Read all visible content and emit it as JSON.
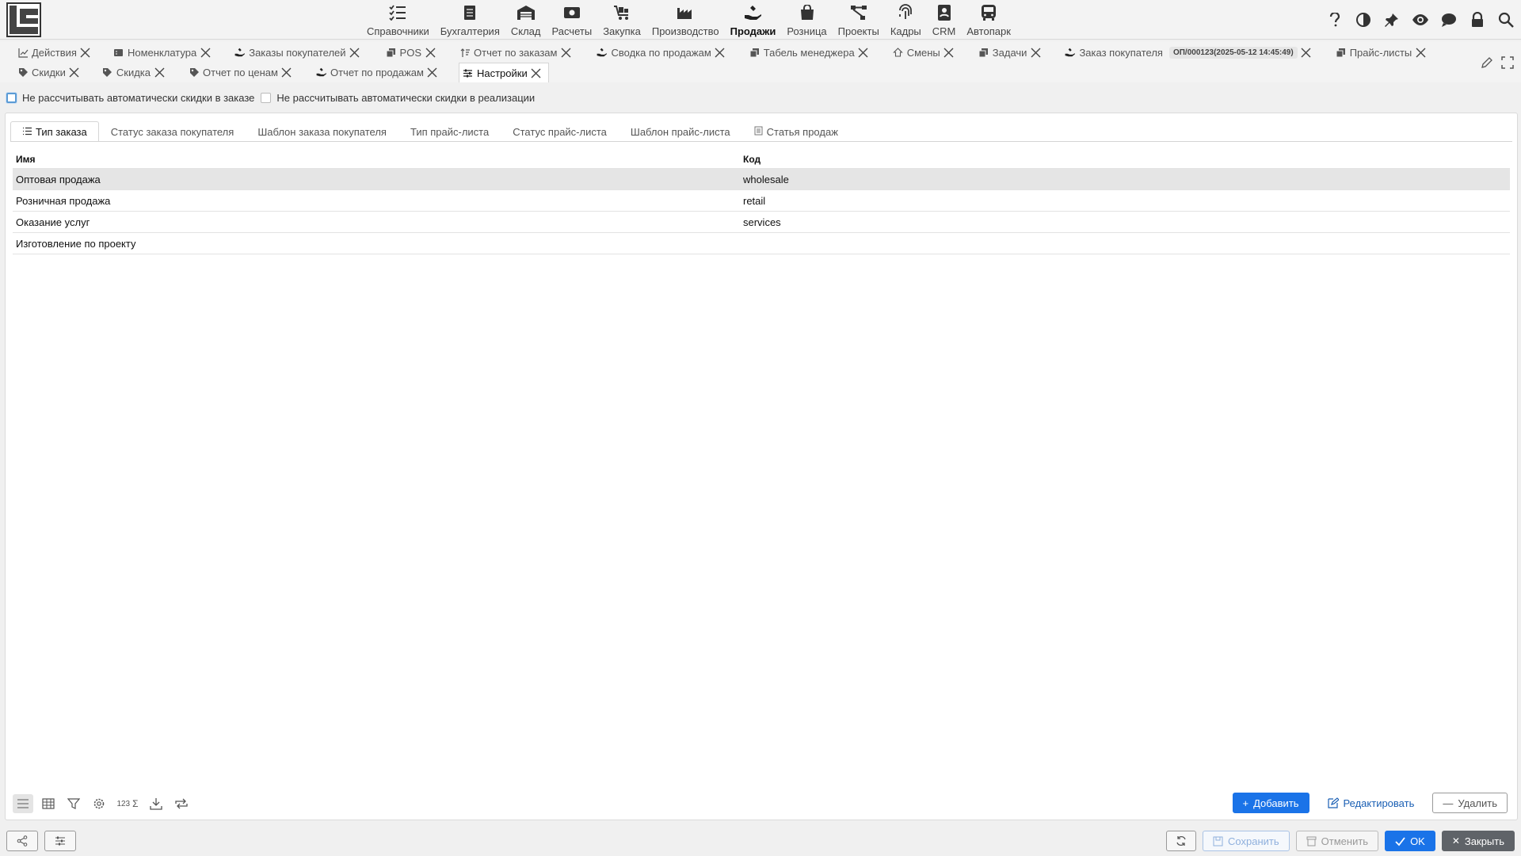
{
  "colors": {
    "primary": "#1a73e8",
    "selected_row": "#e5e5e5",
    "close_button": "#5f6368"
  },
  "menu": [
    {
      "label": "Справочники",
      "icon": "checklist-icon"
    },
    {
      "label": "Бухгалтерия",
      "icon": "ledger-icon"
    },
    {
      "label": "Склад",
      "icon": "warehouse-icon"
    },
    {
      "label": "Расчеты",
      "icon": "money-icon"
    },
    {
      "label": "Закупка",
      "icon": "cart-icon"
    },
    {
      "label": "Производство",
      "icon": "factory-icon"
    },
    {
      "label": "Продажи",
      "icon": "sales-hand-icon",
      "active": true
    },
    {
      "label": "Розница",
      "icon": "shopping-bag-icon"
    },
    {
      "label": "Проекты",
      "icon": "project-nodes-icon"
    },
    {
      "label": "Кадры",
      "icon": "fingerprint-icon"
    },
    {
      "label": "CRM",
      "icon": "contact-card-icon"
    },
    {
      "label": "Автопарк",
      "icon": "bus-icon"
    }
  ],
  "top_right_icons": [
    "help-icon",
    "contrast-icon",
    "pin-icon",
    "eye-icon",
    "chat-icon",
    "lock-icon",
    "search-icon"
  ],
  "doc_tabs": {
    "row1": [
      {
        "label": "Действия",
        "icon": "chart-line-icon"
      },
      {
        "label": "Номенклатура",
        "icon": "nomenclature-icon"
      },
      {
        "label": "Заказы покупателей",
        "icon": "sales-hand-icon"
      },
      {
        "label": "POS",
        "icon": "copy-icon"
      },
      {
        "label": "Отчет по заказам",
        "icon": "sort-icon"
      },
      {
        "label": "Сводка по продажам",
        "icon": "sales-hand-icon"
      },
      {
        "label": "Табель менеджера",
        "icon": "copy-icon"
      },
      {
        "label": "Смены",
        "icon": "shift-icon"
      },
      {
        "label": "Задачи",
        "icon": "copy-icon"
      },
      {
        "label": "Заказ покупателя",
        "icon": "sales-hand-icon",
        "badge": "ОП/000123(2025-05-12 14:45:49)"
      },
      {
        "label": "Прайс-листы",
        "icon": "copy-icon"
      }
    ],
    "row2": [
      {
        "label": "Скидки",
        "icon": "tag-icon"
      },
      {
        "label": "Скидка",
        "icon": "tag-icon"
      },
      {
        "label": "Отчет по ценам",
        "icon": "tag-icon"
      },
      {
        "label": "Отчет по продажам",
        "icon": "sales-hand-icon"
      },
      {
        "label": "Настройки",
        "icon": "sliders-icon",
        "active": true
      }
    ]
  },
  "options": {
    "opt1": "Не рассчитывать автоматически скидки в заказе",
    "opt2": "Не рассчитывать автоматически скидки в реализации"
  },
  "subtabs": [
    {
      "label": "Тип заказа",
      "active": true,
      "icon": "list-icon"
    },
    {
      "label": "Статус заказа покупателя"
    },
    {
      "label": "Шаблон заказа покупателя"
    },
    {
      "label": "Тип прайс-листа"
    },
    {
      "label": "Статус прайс-листа"
    },
    {
      "label": "Шаблон прайс-листа"
    },
    {
      "label": "Статья продаж",
      "icon": "document-icon"
    }
  ],
  "grid": {
    "columns": [
      "Имя",
      "Код"
    ],
    "rows": [
      [
        "Оптовая продажа",
        "wholesale"
      ],
      [
        "Розничная продажа",
        "retail"
      ],
      [
        "Оказание услуг",
        "services"
      ],
      [
        "Изготовление по проекту",
        ""
      ]
    ]
  },
  "toolbar": {
    "count_label": "123",
    "add": "Добавить",
    "edit": "Редактировать",
    "delete": "Удалить"
  },
  "footer": {
    "save": "Сохранить",
    "cancel": "Отменить",
    "ok": "OK",
    "close": "Закрыть"
  }
}
